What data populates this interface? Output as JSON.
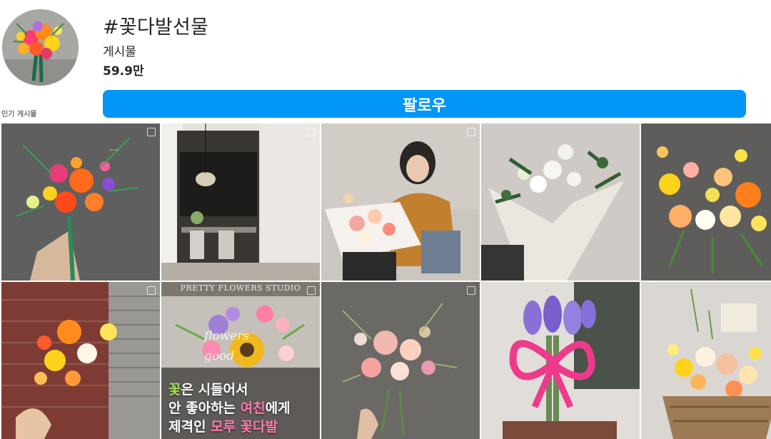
{
  "header": {
    "hashtag": "#꽃다발선물",
    "posts_label": "게시물",
    "posts_count": "59.9만",
    "follow_label": "팔로우"
  },
  "section": {
    "label": "인기 게시물"
  },
  "grid": {
    "tiles": [
      {
        "name": "post-bouquet-orange-gerbera",
        "multi": true
      },
      {
        "name": "post-interior-room",
        "multi": true
      },
      {
        "name": "post-woman-with-bouquet",
        "multi": true
      },
      {
        "name": "post-white-green-bouquet",
        "multi": false
      },
      {
        "name": "post-yellow-ranunculus-bouquet",
        "multi": false
      },
      {
        "name": "post-brick-wall-bouquet",
        "multi": true
      },
      {
        "name": "post-magazine-sunflower",
        "multi": true
      },
      {
        "name": "post-pink-rose-bouquet",
        "multi": true
      },
      {
        "name": "post-balloon-tulips",
        "multi": false
      },
      {
        "name": "post-basket-arrangement",
        "multi": false
      }
    ],
    "magazine_header": "PRETTY FLOWERS STUDIO",
    "magazine_script_1": "flowers",
    "magazine_script_2": "good",
    "overlay_line1_a": "꽃",
    "overlay_line1_b": "은 시들어서",
    "overlay_line2_a": "안 좋아하는 ",
    "overlay_line2_b": "여친",
    "overlay_line2_c": "에게",
    "overlay_line3_a": "제격인 ",
    "overlay_line3_b": "모루 꽃다발"
  },
  "colors": {
    "follow_button": "#0095f6",
    "accent_green": "#a4e05a",
    "accent_pink": "#ff7bb0"
  }
}
